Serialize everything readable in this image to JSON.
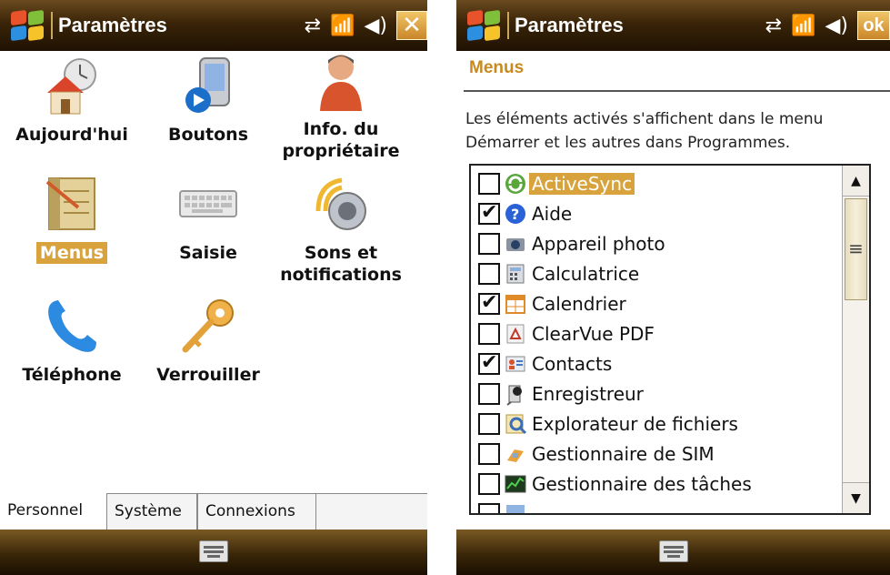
{
  "left": {
    "title": "Paramètres",
    "grid": [
      {
        "label": "Aujourd'hui",
        "icon": "today-house-clock-icon"
      },
      {
        "label": "Boutons",
        "icon": "buttons-device-icon"
      },
      {
        "label": "Info. du\npropriétaire",
        "icon": "owner-person-icon"
      },
      {
        "label": "Menus",
        "icon": "menus-icon",
        "selected": true
      },
      {
        "label": "Saisie",
        "icon": "keyboard-icon"
      },
      {
        "label": "Sons et\nnotifications",
        "icon": "sounds-speaker-icon"
      },
      {
        "label": "Téléphone",
        "icon": "phone-handset-icon"
      },
      {
        "label": "Verrouiller",
        "icon": "lock-key-icon"
      }
    ],
    "tabs": [
      {
        "label": "Personnel",
        "active": true
      },
      {
        "label": "Système",
        "active": false
      },
      {
        "label": "Connexions",
        "active": false
      }
    ]
  },
  "right": {
    "title": "Paramètres",
    "ok_label": "ok",
    "section_title": "Menus",
    "description": "Les éléments activés s'affichent dans le menu Démarrer et les autres dans Programmes.",
    "items": [
      {
        "label": "ActiveSync",
        "checked": false,
        "selected": true,
        "icon": "activesync-icon"
      },
      {
        "label": "Aide",
        "checked": true,
        "selected": false,
        "icon": "help-icon"
      },
      {
        "label": "Appareil photo",
        "checked": false,
        "selected": false,
        "icon": "camera-icon"
      },
      {
        "label": "Calculatrice",
        "checked": false,
        "selected": false,
        "icon": "calculator-icon"
      },
      {
        "label": "Calendrier",
        "checked": true,
        "selected": false,
        "icon": "calendar-icon"
      },
      {
        "label": "ClearVue PDF",
        "checked": false,
        "selected": false,
        "icon": "pdf-icon"
      },
      {
        "label": "Contacts",
        "checked": true,
        "selected": false,
        "icon": "contacts-icon"
      },
      {
        "label": "Enregistreur",
        "checked": false,
        "selected": false,
        "icon": "recorder-icon"
      },
      {
        "label": "Explorateur de fichiers",
        "checked": false,
        "selected": false,
        "icon": "file-explorer-icon"
      },
      {
        "label": "Gestionnaire de SIM",
        "checked": false,
        "selected": false,
        "icon": "sim-manager-icon"
      },
      {
        "label": "Gestionnaire des tâches",
        "checked": false,
        "selected": false,
        "icon": "task-manager-icon"
      }
    ]
  },
  "status_icons": [
    "sync-arrows-icon",
    "signal-icon",
    "volume-icon"
  ],
  "colors": {
    "accent": "#d8a33c",
    "titlebar": "#3a2408",
    "section_title": "#c88a1f"
  }
}
